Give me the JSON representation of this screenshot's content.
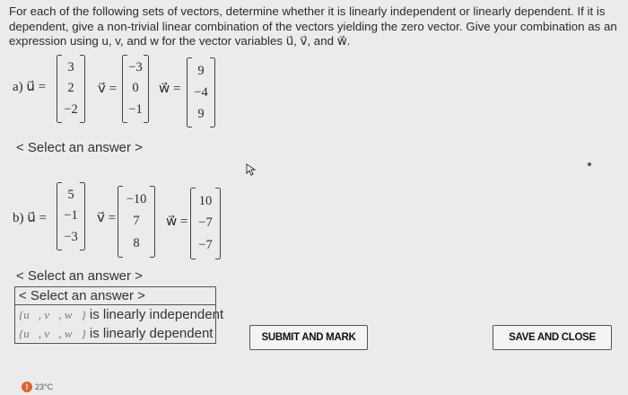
{
  "instructions": {
    "text": "For each of the following sets of vectors, determine whether it is linearly independent or linearly dependent. If it is dependent, give a non-trivial linear combination of the vectors yielding the zero vector. Give your combination as an expression using u, v, and w for the vector variables ",
    "u": "u⃗",
    "sep1": ", ",
    "v": "v⃗",
    "sep2": ", and ",
    "w": "w⃗",
    "end": "."
  },
  "part_a": {
    "label": "a) u⃗ =",
    "u": [
      "3",
      "2",
      "−2"
    ],
    "v_label": "v⃗ =",
    "v": [
      "−3",
      "0",
      "−1"
    ],
    "w_label": "w⃗ =",
    "w": [
      "9",
      "−4",
      "9"
    ],
    "select": "< Select an answer >"
  },
  "part_b": {
    "label": "b) u⃗ =",
    "u": [
      "5",
      "−1",
      "−3"
    ],
    "v_label": "v⃗ =",
    "v": [
      "−10",
      "7",
      "8"
    ],
    "w_label": "w⃗ =",
    "w": [
      "10",
      "−7",
      "−7"
    ],
    "select": "< Select an answer >"
  },
  "dropdown": {
    "options": [
      {
        "set": "",
        "text": "< Select an answer >"
      },
      {
        "set": "{u⃗, v⃗, w⃗}",
        "text": " is linearly independent"
      },
      {
        "set": "{u⃗, v⃗, w⃗}",
        "text": " is linearly dependent"
      }
    ]
  },
  "buttons": {
    "submit": "SUBMIT AND MARK",
    "save": "SAVE AND CLOSE"
  },
  "status": {
    "icon": "warning-icon",
    "temperature": "23°C"
  }
}
